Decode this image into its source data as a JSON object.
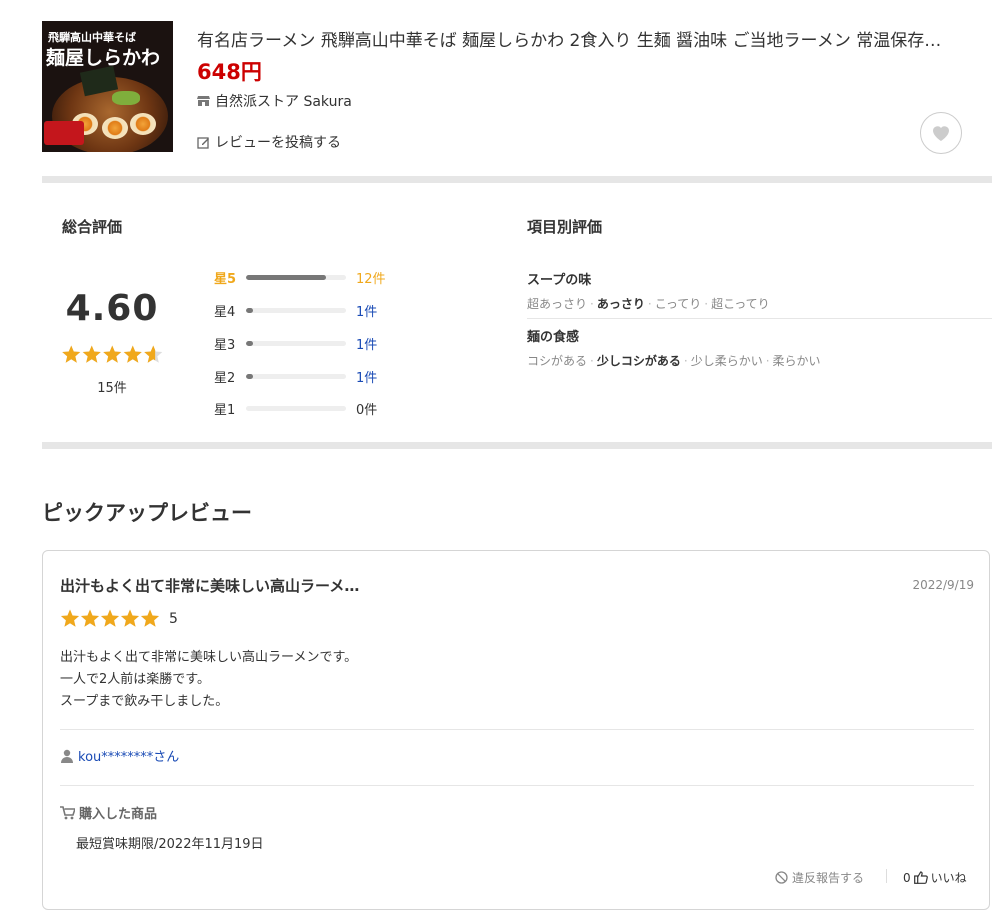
{
  "product": {
    "title": "有名店ラーメン 飛騨高山中華そば 麺屋しらかわ 2食入り 生麺 醤油味 ご当地ラーメン 常温保存…",
    "price": "648円",
    "store": "自然派ストア Sakura",
    "review_post": "レビューを投稿する",
    "image_text_top": "飛騨高山中華そば",
    "image_text_main": "麺屋しらかわ"
  },
  "summary": {
    "overall_heading": "総合評価",
    "average": "4.60",
    "average_value": 4.6,
    "total": "15件",
    "distribution": [
      {
        "label": "星5",
        "count": "12件",
        "fraction": 0.8
      },
      {
        "label": "星4",
        "count": "1件",
        "fraction": 0.067
      },
      {
        "label": "星3",
        "count": "1件",
        "fraction": 0.067
      },
      {
        "label": "星2",
        "count": "1件",
        "fraction": 0.067
      },
      {
        "label": "星1",
        "count": "0件",
        "fraction": 0
      }
    ],
    "attributes_heading": "項目別評価",
    "attributes": [
      {
        "name": "スープの味",
        "options": [
          "超あっさり",
          "あっさり",
          "こってり",
          "超こってり"
        ],
        "selected": 1
      },
      {
        "name": "麺の食感",
        "options": [
          "コシがある",
          "少しコシがある",
          "少し柔らかい",
          "柔らかい"
        ],
        "selected": 1
      }
    ]
  },
  "pickup": {
    "heading": "ピックアップレビュー",
    "review": {
      "title": "出汁もよく出て非常に美味しい高山ラーメ…",
      "date": "2022/9/19",
      "rating": 5,
      "rating_label": "5",
      "body": [
        "出汁もよく出て非常に美味しい高山ラーメンです。",
        "一人で2人前は楽勝です。",
        "スープまで飲み干しました。"
      ],
      "user": "kou********さん",
      "purchased_label": "購入した商品",
      "purchased_item": "最短賞味期限/2022年11月19日",
      "report": "違反報告する",
      "like_count": "0",
      "like_label": "いいね"
    }
  },
  "colors": {
    "price": "#cc0000",
    "star": "#f0a81c",
    "link": "#1a4bb5"
  },
  "icons": [
    "store-icon",
    "edit-icon",
    "heart-icon",
    "user-icon",
    "cart-icon",
    "prohibited-icon",
    "thumbs-up-icon"
  ]
}
